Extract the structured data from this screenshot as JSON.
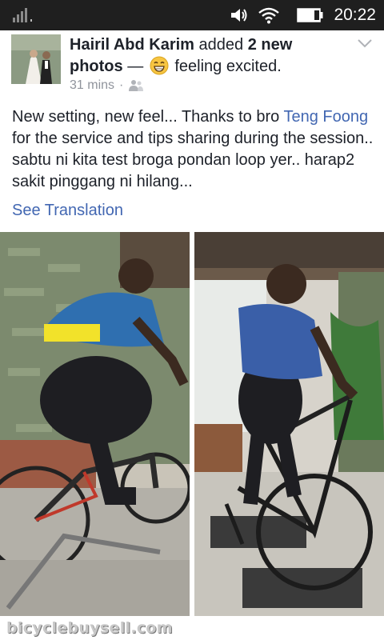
{
  "status_bar": {
    "time": "20:22",
    "icons": [
      "signal-icon",
      "volume-icon",
      "wifi-icon",
      "battery-icon"
    ]
  },
  "post": {
    "author": "Hairil Abd Karim",
    "action_text": "added",
    "photo_count": "2 new photos",
    "feeling_connector": "—",
    "feeling": "feeling excited.",
    "time_ago": "31 mins",
    "separator": "·",
    "body_part1": "New setting, new feel... Thanks to bro ",
    "mention": "Teng Foong",
    "body_part2": " for the service and tips sharing during the session.. sabtu ni kita test broga pondan loop yer.. harap2 sakit pinggang ni hilang...",
    "see_translation": "See Translation"
  },
  "watermark": "bicyclebuysell.com",
  "colors": {
    "link": "#4267b2",
    "text": "#1d2129",
    "meta": "#90949c",
    "statusbar": "#1f1f1f"
  }
}
